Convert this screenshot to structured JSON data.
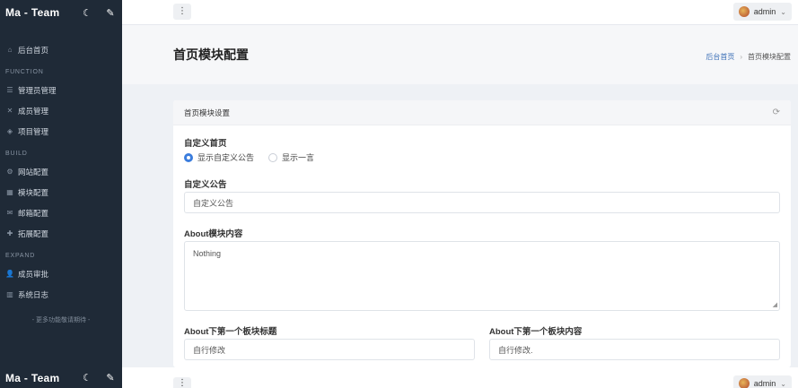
{
  "app": {
    "title": "Ma - Team",
    "theme_icon": "moon-icon",
    "edit_icon": "pencil-icon"
  },
  "sidebar": {
    "home": {
      "label": "后台首页",
      "icon": "home-icon"
    },
    "sections": [
      {
        "heading": "FUNCTION",
        "items": [
          {
            "label": "管理员管理",
            "icon": "list-icon"
          },
          {
            "label": "成员管理",
            "icon": "tools-icon"
          },
          {
            "label": "项目管理",
            "icon": "layers-icon"
          }
        ]
      },
      {
        "heading": "BUILD",
        "items": [
          {
            "label": "网站配置",
            "icon": "cogs-icon"
          },
          {
            "label": "模块配置",
            "icon": "box-icon"
          },
          {
            "label": "邮箱配置",
            "icon": "mail-icon"
          },
          {
            "label": "拓展配置",
            "icon": "puzzle-icon"
          }
        ]
      },
      {
        "heading": "EXPAND",
        "items": [
          {
            "label": "成员审批",
            "icon": "user-plus-icon"
          },
          {
            "label": "系统日志",
            "icon": "chart-icon"
          }
        ]
      }
    ],
    "footer": "- 更多功能敬请期待 -"
  },
  "topbar": {
    "menu_icon": "dots-vertical-icon",
    "user": "admin"
  },
  "page": {
    "title": "首页模块配置",
    "breadcrumb": [
      "后台首页",
      "首页模块配置"
    ]
  },
  "card": {
    "title": "首页模块设置",
    "fields": {
      "home_label": "自定义首页",
      "home_options": [
        "显示自定义公告",
        "显示一言"
      ],
      "home_selected": 0,
      "notice_label": "自定义公告",
      "notice_value": "自定义公告",
      "about_label": "About模块内容",
      "about_value": "Nothing",
      "about_next_title_label": "About下第一个板块标题",
      "about_next_title_value": "自行修改",
      "about_next_content_label": "About下第一个板块内容",
      "about_next_content_value": "自行修改."
    }
  },
  "colors": {
    "sidebar_bg": "#1f2a37",
    "accent": "#3b7ddd",
    "link": "#3b6fb6"
  }
}
